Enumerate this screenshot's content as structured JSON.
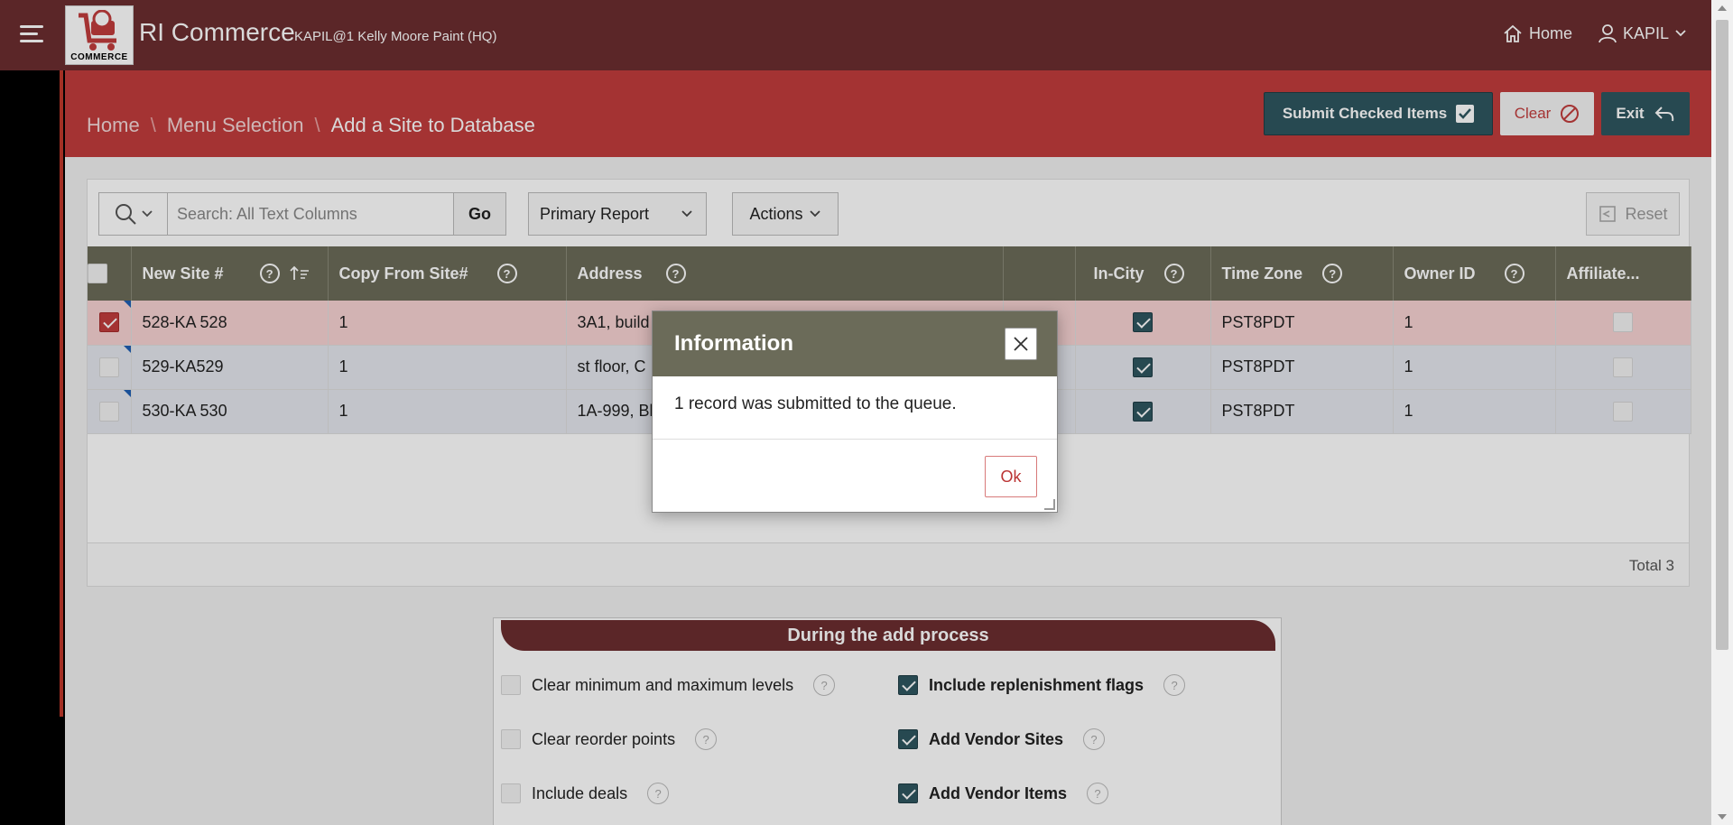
{
  "header": {
    "app_title": "RI Commerce",
    "app_subtitle": "KAPIL@1 Kelly Moore Paint (HQ)",
    "logo_text": "COMMERCE",
    "nav_home": "Home",
    "user": "KAPIL"
  },
  "breadcrumb": {
    "items": [
      "Home",
      "Menu Selection"
    ],
    "current": "Add a Site to Database",
    "separator": "\\"
  },
  "buttons": {
    "submit": "Submit Checked Items",
    "clear": "Clear",
    "exit": "Exit"
  },
  "toolbar": {
    "search_placeholder": "Search: All Text Columns",
    "go": "Go",
    "report": "Primary Report",
    "actions": "Actions",
    "reset": "Reset"
  },
  "table": {
    "columns": [
      "New Site #",
      "Copy From Site#",
      "Address",
      "",
      "In-City",
      "Time Zone",
      "Owner ID",
      "Affiliate..."
    ],
    "rows": [
      {
        "selected": true,
        "site": "528-KA 528",
        "copy_from": "1",
        "address": "3A1, build",
        "in_city": true,
        "tz": "PST8PDT",
        "owner": "1",
        "affiliate": false
      },
      {
        "selected": false,
        "site": "529-KA529",
        "copy_from": "1",
        "address": "st floor, C",
        "in_city": true,
        "tz": "PST8PDT",
        "owner": "1",
        "affiliate": false
      },
      {
        "selected": false,
        "site": "530-KA 530",
        "copy_from": "1",
        "address": "1A-999, Bl",
        "in_city": true,
        "tz": "PST8PDT",
        "owner": "1",
        "affiliate": false
      }
    ],
    "total": "Total 3"
  },
  "options": {
    "title": "During the add process",
    "left": [
      {
        "label": "Clear minimum and maximum levels",
        "checked": false
      },
      {
        "label": "Clear reorder points",
        "checked": false
      },
      {
        "label": "Include deals",
        "checked": false
      }
    ],
    "right": [
      {
        "label": "Include replenishment flags",
        "checked": true
      },
      {
        "label": "Add Vendor Sites",
        "checked": true
      },
      {
        "label": "Add Vendor Items",
        "checked": true
      }
    ]
  },
  "dialog": {
    "title": "Information",
    "message": "1 record was submitted to the queue.",
    "ok": "Ok"
  },
  "colors": {
    "header": "#6b2d2f",
    "hero": "#c13d3d",
    "teal": "#2e5660",
    "grid_header": "#6b6b59"
  }
}
